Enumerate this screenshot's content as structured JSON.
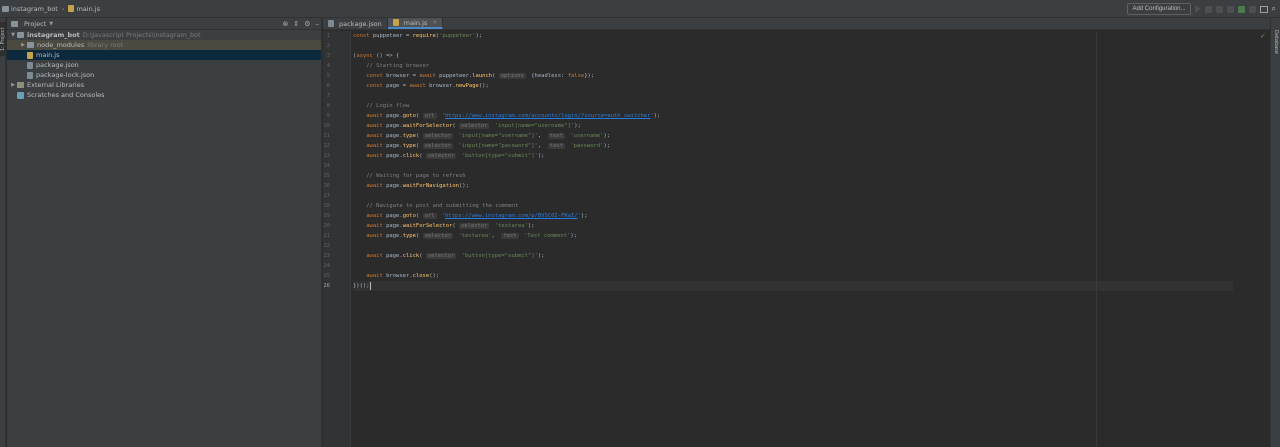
{
  "breadcrumb": {
    "project": "instagram_bot",
    "file": "main.js"
  },
  "toolbar": {
    "add_config_label": "Add Configuration..."
  },
  "left_stripe": {
    "label": "1: Project"
  },
  "right_stripe": {
    "label": "Database"
  },
  "project_panel": {
    "title": "Project",
    "tree": [
      {
        "name": "instagram_bot",
        "note": "D:\\Javascript Projects\\instagram_bot",
        "level": 0,
        "arrow": "▼",
        "icon": "folder"
      },
      {
        "name": "node_modules",
        "note": "library root",
        "level": 1,
        "arrow": "▶",
        "icon": "folder"
      },
      {
        "name": "main.js",
        "note": "",
        "level": 1,
        "arrow": "",
        "icon": "js"
      },
      {
        "name": "package.json",
        "note": "",
        "level": 1,
        "arrow": "",
        "icon": "json"
      },
      {
        "name": "package-lock.json",
        "note": "",
        "level": 1,
        "arrow": "",
        "icon": "json"
      },
      {
        "name": "External Libraries",
        "note": "",
        "level": 0,
        "arrow": "▶",
        "icon": "lib"
      },
      {
        "name": "Scratches and Consoles",
        "note": "",
        "level": 0,
        "arrow": "",
        "icon": "scratch"
      }
    ]
  },
  "tabs": [
    {
      "label": "package.json",
      "active": false
    },
    {
      "label": "main.js",
      "active": true
    }
  ],
  "code_lines": [
    "const puppeteer = require('puppeteer');",
    "",
    "(async () => {",
    "    // Starting browser",
    "    const browser = await puppeteer.launch( options {headless: false});",
    "    const page = await browser.newPage();",
    "",
    "    // Login flow",
    "    await page.goto( url 'https://www.instagram.com/accounts/login/?source=auth_switcher');",
    "    await page.waitForSelector( selector 'input[name=\"username\"]');",
    "    await page.type( selector 'input[name=\"username\"]',  text 'username');",
    "    await page.type( selector 'input[name=\"password\"]',  text 'password');",
    "    await page.click( selector 'button[type=\"submit\"]');",
    "",
    "    // Waiting for page to refresh",
    "    await page.waitForNavigation();",
    "",
    "    // Navigate to post and submitting the comment",
    "    await page.goto( url 'https://www.instagram.com/p/BVSC0I-FRaI/');",
    "    await page.waitForSelector( selector 'textarea');",
    "    await page.type( selector 'textarea',  text 'Test comment');",
    "",
    "    await page.click( selector 'button[type=\"submit\"]');",
    "",
    "    await browser.close();",
    "})();"
  ],
  "current_line": 26
}
